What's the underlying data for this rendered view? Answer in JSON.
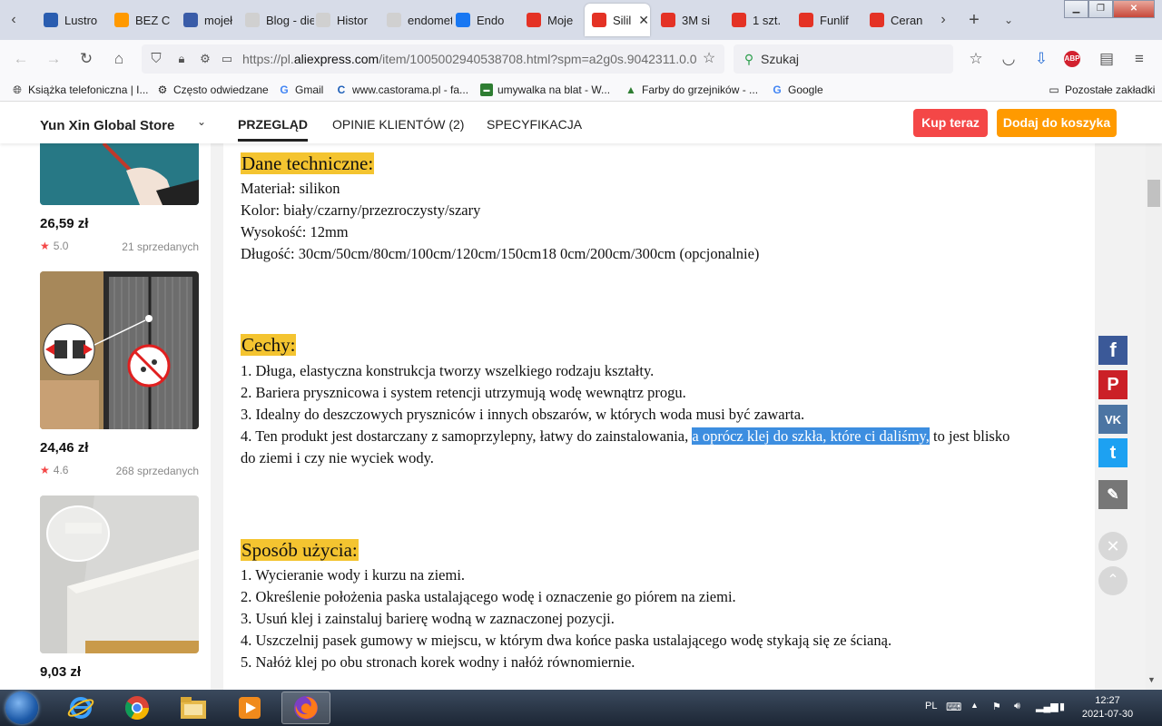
{
  "browser": {
    "tabs": [
      {
        "label": "Lustro",
        "icon": "zylinder-favicon",
        "color": "#2a5db0"
      },
      {
        "label": "BEZ C",
        "icon": "amazon-favicon",
        "color": "#ff9900"
      },
      {
        "label": "mojeł",
        "icon": "globe-favicon",
        "color": "#3a5ca8"
      },
      {
        "label": "Blog - diet",
        "icon": "blog-favicon",
        "color": "#d0d0d0"
      },
      {
        "label": "Histor",
        "icon": "medicover-favicon",
        "color": "#d0d0d0"
      },
      {
        "label": "endometri",
        "icon": "blank-favicon",
        "color": "#d0d0d0"
      },
      {
        "label": "Endo",
        "icon": "facebook-favicon",
        "color": "#1877f2"
      },
      {
        "label": "Moje",
        "icon": "aliexpress-favicon",
        "color": "#e43225"
      },
      {
        "label": "Silil",
        "icon": "aliexpress-favicon",
        "color": "#e43225",
        "active": true
      },
      {
        "label": "3M si",
        "icon": "aliexpress-favicon",
        "color": "#e43225"
      },
      {
        "label": "1 szt.",
        "icon": "aliexpress-favicon",
        "color": "#e43225"
      },
      {
        "label": "Funlif",
        "icon": "aliexpress-favicon",
        "color": "#e43225"
      },
      {
        "label": "Ceran",
        "icon": "aliexpress-favicon",
        "color": "#e43225"
      }
    ],
    "url_prefix": "https://pl.",
    "url_domain": "aliexpress.com",
    "url_rest": "/item/1005002940538708.html?spm=a2g0s.9042311.0.0",
    "search_placeholder": "Szukaj",
    "bookmarks": [
      "Książka telefoniczna | I...",
      "Często odwiedzane",
      "Gmail",
      "www.castorama.pl - fa...",
      "umywalka na blat - W...",
      "Farby do grzejników - ...",
      "Google"
    ],
    "other_bookmarks": "Pozostałe zakładki"
  },
  "store": {
    "name": "Yun Xin Global Store",
    "tabs": [
      "PRZEGLĄD",
      "OPINIE KLIENTÓW (2)",
      "SPECYFIKACJA"
    ],
    "buy_now": "Kup teraz",
    "add_to_cart": "Dodaj do koszyka"
  },
  "sidebar_products": [
    {
      "price": "26,59 zł",
      "rating": "5.0",
      "sold": "21 sprzedanych"
    },
    {
      "price": "24,46 zł",
      "rating": "4.6",
      "sold": "268 sprzedanych"
    },
    {
      "price": "9,03 zł"
    }
  ],
  "description": {
    "tech_heading": "Dane techniczne:",
    "tech_lines": [
      "Materiał: silikon",
      "Kolor: biały/czarny/przezroczysty/szary",
      "Wysokość: 12mm",
      "Długość: 30cm/50cm/80cm/100cm/120cm/150cm18 0cm/200cm/300cm (opcjonalnie)"
    ],
    "features_heading": "Cechy:",
    "features_lines": [
      "1. Długa, elastyczna konstrukcja tworzy wszelkiego rodzaju kształty.",
      "2. Bariera prysznicowa i system retencji utrzymują wodę wewnątrz progu.",
      "3. Idealny do deszczowych pryszniców i innych obszarów, w których woda musi być zawarta."
    ],
    "feature4_a": "4. Ten produkt jest dostarczany z samoprzylepny, łatwy do zainstalowania, ",
    "feature4_highlight": "a oprócz klej do szkła, które ci daliśmy,",
    "feature4_b": " to jest blisko",
    "feature4_c": "do ziemi i czy nie wyciek wody.",
    "usage_heading": "Sposób użycia:",
    "usage_lines": [
      "1. Wycieranie wody i kurzu na ziemi.",
      "2. Określenie położenia paska ustalającego wodę i oznaczenie go piórem na ziemi.",
      "3. Usuń klej i zainstaluj barierę wodną w zaznaczonej pozycji.",
      "4. Uszczelnij pasek gumowy w miejscu, w którym dwa końce paska ustalającego wodę stykają się ze ścianą.",
      "5. Nałóż klej po obu stronach korek wodny i nałóż równomiernie."
    ]
  },
  "share": {
    "facebook": "f",
    "pinterest": "P",
    "vk": "VK",
    "twitter": "t"
  },
  "taskbar": {
    "language": "PL",
    "time": "12:27",
    "date": "2021-07-30"
  }
}
